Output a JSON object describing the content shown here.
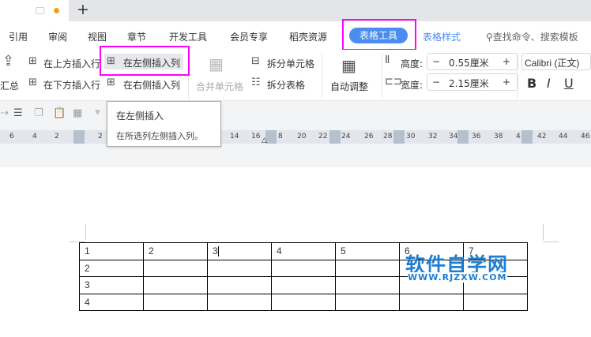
{
  "tabbar": {
    "new_tab": "+"
  },
  "menu": {
    "items": [
      "引用",
      "审阅",
      "视图",
      "章节",
      "开发工具",
      "会员专享",
      "稻壳资源"
    ],
    "active": "表格工具",
    "table_style": "表格样式",
    "search": "查找命令、搜索模板"
  },
  "ribbon": {
    "summary": "汇总",
    "insert_above": "在上方插入行",
    "insert_below": "在下方插入行",
    "insert_left": "在左侧插入列",
    "insert_right": "在右侧插入列",
    "merge": "合并单元格",
    "split_cell": "拆分单元格",
    "split_table": "拆分表格",
    "auto_fit": "自动调整",
    "height_label": "高度:",
    "height_value": "0.55厘米",
    "width_label": "宽度:",
    "width_value": "2.15厘米",
    "minus": "−",
    "plus": "+",
    "font": "Calibri (正文)",
    "bold": "B",
    "italic": "I",
    "underline": "U"
  },
  "tooltip": {
    "title": "在左侧插入",
    "desc": "在所选列左侧插入列。"
  },
  "ruler": {
    "labels": [
      "6",
      "4",
      "2",
      "2",
      "14",
      "16",
      "8",
      "20",
      "22",
      "24",
      "26",
      "28",
      "30",
      "32",
      "34",
      "36",
      "38",
      "4",
      "42",
      "44",
      "46"
    ]
  },
  "table": {
    "rows": [
      [
        "1",
        "2",
        "3",
        "4",
        "5",
        "6",
        "7"
      ],
      [
        "2",
        "",
        "",
        "",
        "",
        "",
        ""
      ],
      [
        "3",
        "",
        "",
        "",
        "",
        "",
        ""
      ],
      [
        "4",
        "",
        "",
        "",
        "",
        "",
        ""
      ]
    ]
  },
  "watermark": {
    "title": "软件自学网",
    "url": "WWW.RJZXW.COM"
  },
  "colors": {
    "accent": "#4a8cf0",
    "highlight": "#ff00ff"
  }
}
